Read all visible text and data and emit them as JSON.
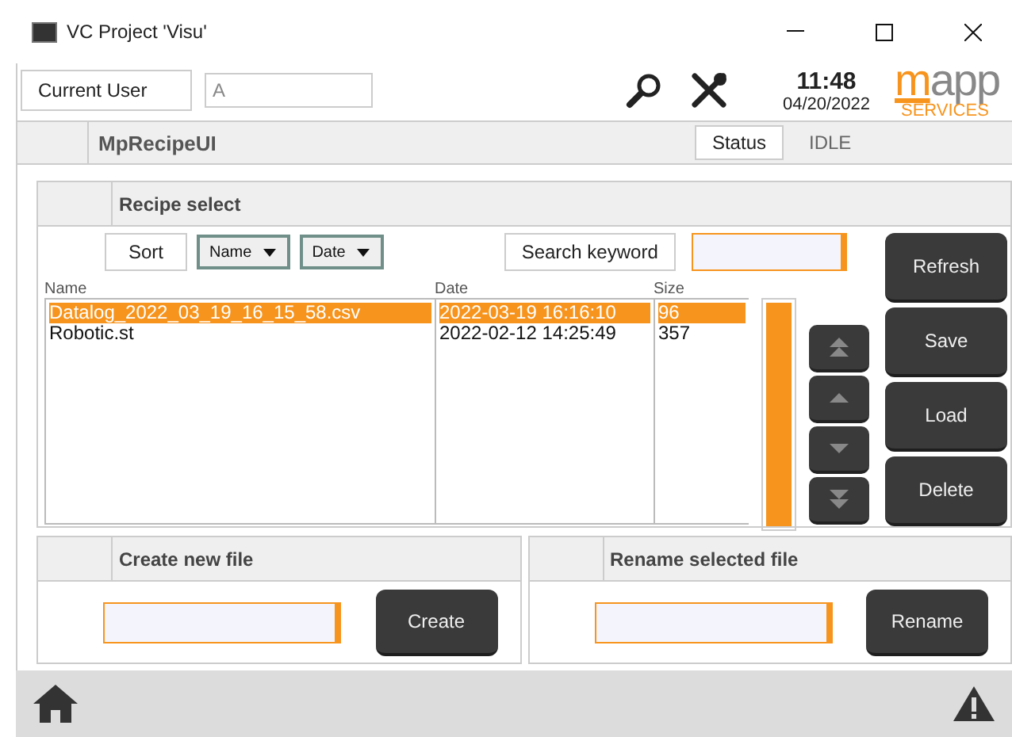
{
  "window": {
    "title": "VC Project 'Visu'"
  },
  "header": {
    "user_label": "Current User",
    "user_value": "A",
    "time": "11:48",
    "date": "04/20/2022",
    "logo_main": "mapp",
    "logo_sub": "SERVICES"
  },
  "page": {
    "title": "MpRecipeUI",
    "status_label": "Status",
    "status_value": "IDLE"
  },
  "recipe_select": {
    "title": "Recipe select",
    "sort_label": "Sort",
    "sort_options": [
      "Name",
      "Date"
    ],
    "search_label": "Search keyword",
    "columns": [
      "Name",
      "Date",
      "Size"
    ],
    "rows": [
      {
        "name": "Datalog_2022_03_19_16_15_58.csv",
        "date": "2022-03-19 16:16:10",
        "size": "96",
        "selected": true
      },
      {
        "name": "Robotic.st",
        "date": "2022-02-12 14:25:49",
        "size": "357",
        "selected": false
      }
    ],
    "buttons": [
      "Refresh",
      "Save",
      "Load",
      "Delete"
    ]
  },
  "create_panel": {
    "title": "Create new file",
    "button": "Create"
  },
  "rename_panel": {
    "title": "Rename selected file",
    "button": "Rename"
  }
}
